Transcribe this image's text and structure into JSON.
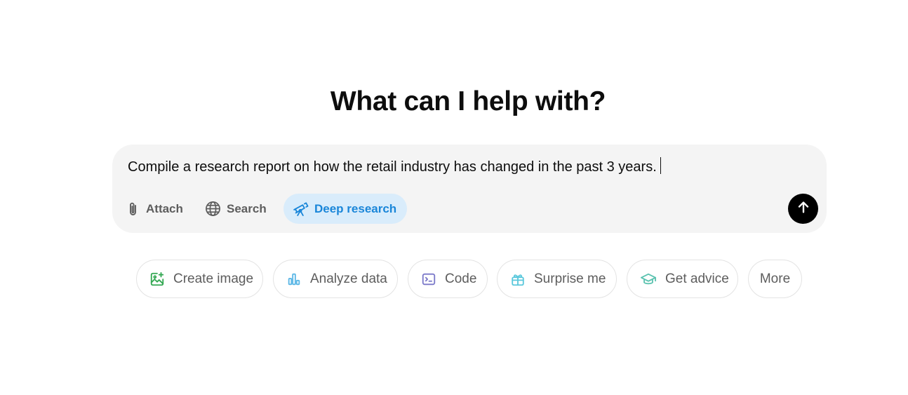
{
  "heading": "What can I help with?",
  "composer": {
    "prompt_text": "Compile a research report on how the retail industry has changed in the past 3 years.",
    "tools": [
      {
        "label": "Attach",
        "icon": "paperclip-icon",
        "active": false
      },
      {
        "label": "Search",
        "icon": "globe-icon",
        "active": false
      },
      {
        "label": "Deep research",
        "icon": "telescope-icon",
        "active": true
      }
    ],
    "send_icon": "arrow-up-icon"
  },
  "suggestions": [
    {
      "label": "Create image",
      "icon": "image-icon",
      "color": "#34a853"
    },
    {
      "label": "Analyze data",
      "icon": "bar-chart-icon",
      "color": "#5bb7e6"
    },
    {
      "label": "Code",
      "icon": "terminal-icon",
      "color": "#7b79c9"
    },
    {
      "label": "Surprise me",
      "icon": "gift-icon",
      "color": "#5bc8dc"
    },
    {
      "label": "Get advice",
      "icon": "graduation-cap-icon",
      "color": "#5cc3b0"
    },
    {
      "label": "More",
      "icon": "",
      "color": "#5d5d5d"
    }
  ],
  "colors": {
    "composer_bg": "#f4f4f4",
    "deep_research_bg": "#d9ecfb",
    "deep_research_text": "#1a86d9",
    "send_button": "#000000"
  }
}
